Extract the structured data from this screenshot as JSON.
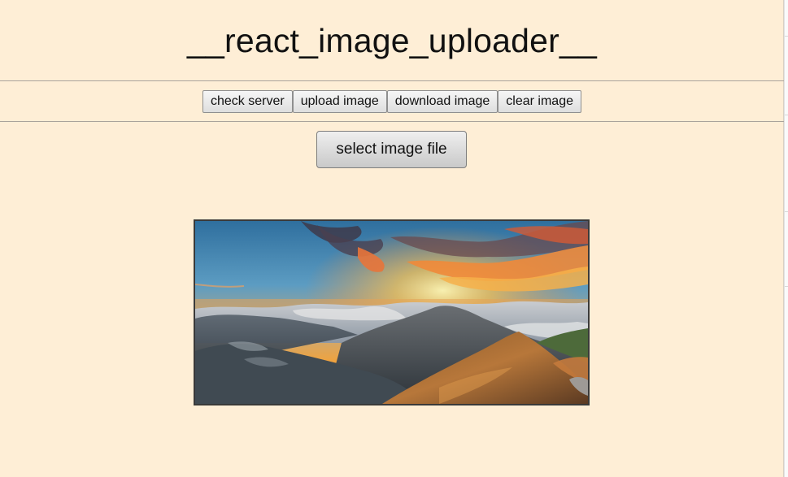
{
  "header": {
    "title": "__react_image_uploader__"
  },
  "toolbar": {
    "check_server": "check server",
    "upload_image": "upload image",
    "download_image": "download image",
    "clear_image": "clear image"
  },
  "file_picker": {
    "label": "select image file"
  },
  "preview": {
    "alt": "mountain sunset landscape"
  },
  "colors": {
    "page_background": "#feeed6",
    "divider": "#a9a39b"
  }
}
